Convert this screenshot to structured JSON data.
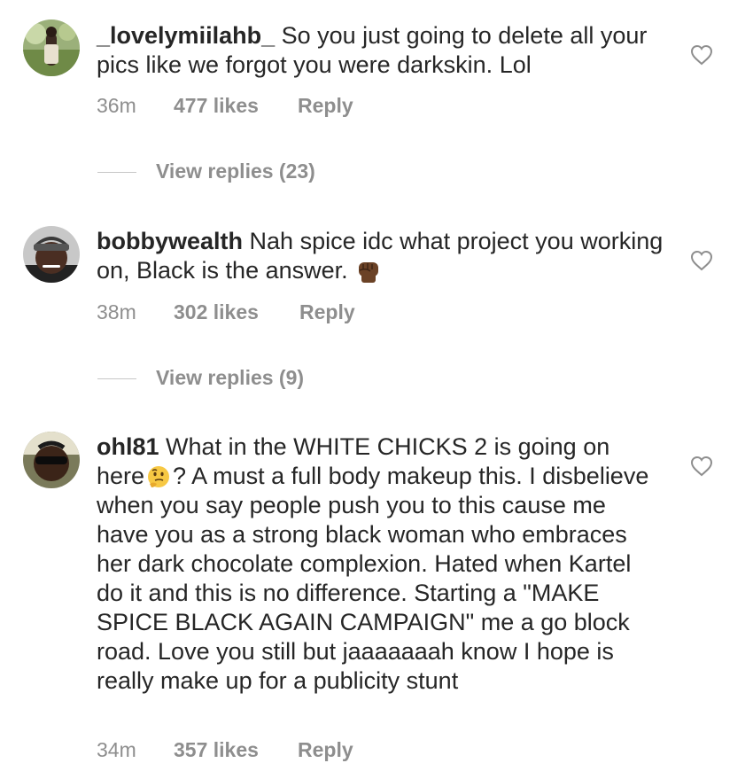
{
  "comments": [
    {
      "username": "_lovelymiilahb_",
      "text": "So you just going to delete all your pics like we forgot you were darkskin. Lol",
      "time": "36m",
      "likes": "477 likes",
      "reply": "Reply",
      "view_replies": "View replies (23)"
    },
    {
      "username": "bobbywealth",
      "text": "Nah spice idc what project you working on, Black is the answer.",
      "emoji": "raised-fist-dark-skin-tone",
      "time": "38m",
      "likes": "302 likes",
      "reply": "Reply",
      "view_replies": "View replies (9)"
    },
    {
      "username": "ohl81",
      "text_before_emoji": "What in the WHITE CHICKS 2 is going on here",
      "emoji": "thinking-face",
      "text_after_emoji": "? A must a full body makeup this. I disbelieve when you say people push you to this cause me have you as a strong black woman who embraces her dark chocolate complexion. Hated when Kartel do it and this is no difference. Starting a \"MAKE SPICE BLACK AGAIN CAMPAIGN\" me a go block road. Love you still but jaaaaaaah know I hope is really make up for a publicity stunt",
      "time": "34m",
      "likes": "357 likes",
      "reply": "Reply"
    }
  ],
  "icons": {
    "like": "heart-outline-icon"
  },
  "colors": {
    "text": "#262626",
    "muted": "#8e8e8e"
  }
}
